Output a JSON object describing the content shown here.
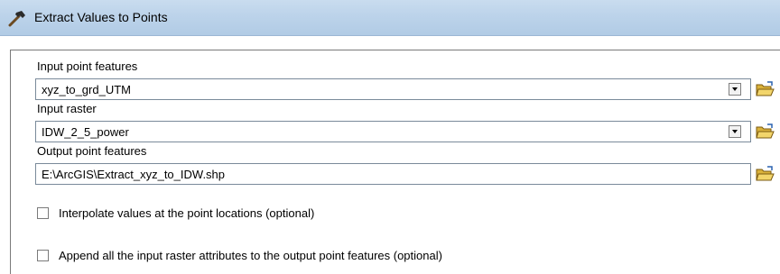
{
  "window": {
    "title": "Extract Values to Points",
    "icon": "hammer-icon"
  },
  "params": {
    "input_points": {
      "label": "Input point features",
      "value": "xyz_to_grd_UTM"
    },
    "input_raster": {
      "label": "Input raster",
      "value": "IDW_2_5_power"
    },
    "output_points": {
      "label": "Output point features",
      "value": "E:\\ArcGIS\\Extract_xyz_to_IDW.shp"
    }
  },
  "options": {
    "interpolate": {
      "label": "Interpolate values at the point locations (optional)",
      "checked": false
    },
    "append": {
      "label": "Append all the input raster attributes to the output point features (optional)",
      "checked": false
    }
  },
  "icons": {
    "browse": "open-folder-icon",
    "dropdown": "dropdown-arrow-icon"
  }
}
